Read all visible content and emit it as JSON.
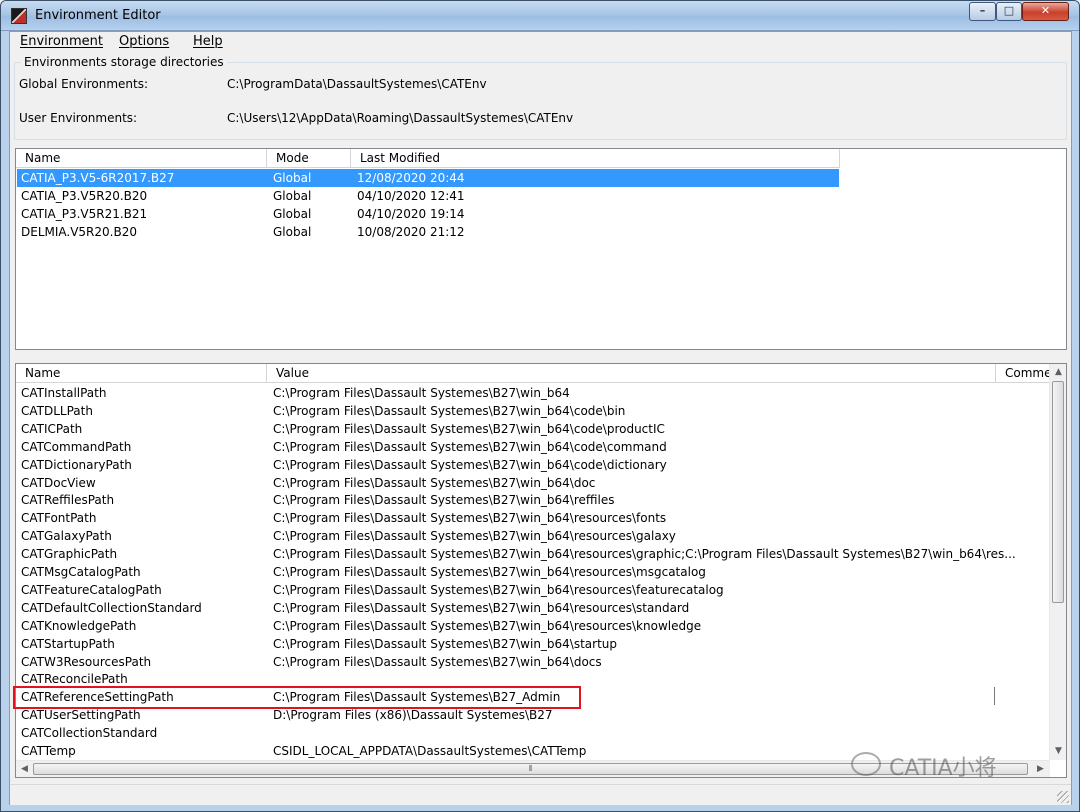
{
  "window": {
    "title": "Environment Editor",
    "controls": {
      "minimize": "–",
      "maximize": "□",
      "close": "✕"
    }
  },
  "menu": [
    "Environment",
    "Options",
    "Help"
  ],
  "storage": {
    "legend": "Environments storage directories",
    "global_label": "Global Environments:",
    "global_path": "C:\\ProgramData\\DassaultSystemes\\CATEnv",
    "user_label": "User   Environments:",
    "user_path": "C:\\Users\\12\\AppData\\Roaming\\DassaultSystemes\\CATEnv"
  },
  "environments": {
    "columns": [
      "Name",
      "Mode",
      "Last Modified"
    ],
    "selected_index": 0,
    "rows": [
      {
        "name": "CATIA_P3.V5-6R2017.B27",
        "mode": "Global",
        "modified": "12/08/2020  20:44"
      },
      {
        "name": "CATIA_P3.V5R20.B20",
        "mode": "Global",
        "modified": "04/10/2020  12:41"
      },
      {
        "name": "CATIA_P3.V5R21.B21",
        "mode": "Global",
        "modified": "04/10/2020  19:14"
      },
      {
        "name": "DELMIA.V5R20.B20",
        "mode": "Global",
        "modified": "10/08/2020  21:12"
      }
    ]
  },
  "variables": {
    "columns": [
      "Name",
      "Value",
      "Comme"
    ],
    "highlighted_index": 17,
    "rows": [
      {
        "name": "CATInstallPath",
        "value": "C:\\Program Files\\Dassault Systemes\\B27\\win_b64"
      },
      {
        "name": "CATDLLPath",
        "value": "C:\\Program Files\\Dassault Systemes\\B27\\win_b64\\code\\bin"
      },
      {
        "name": "CATICPath",
        "value": "C:\\Program Files\\Dassault Systemes\\B27\\win_b64\\code\\productIC"
      },
      {
        "name": "CATCommandPath",
        "value": "C:\\Program Files\\Dassault Systemes\\B27\\win_b64\\code\\command"
      },
      {
        "name": "CATDictionaryPath",
        "value": "C:\\Program Files\\Dassault Systemes\\B27\\win_b64\\code\\dictionary"
      },
      {
        "name": "CATDocView",
        "value": "C:\\Program Files\\Dassault Systemes\\B27\\win_b64\\doc"
      },
      {
        "name": "CATReffilesPath",
        "value": "C:\\Program Files\\Dassault Systemes\\B27\\win_b64\\reffiles"
      },
      {
        "name": "CATFontPath",
        "value": "C:\\Program Files\\Dassault Systemes\\B27\\win_b64\\resources\\fonts"
      },
      {
        "name": "CATGalaxyPath",
        "value": "C:\\Program Files\\Dassault Systemes\\B27\\win_b64\\resources\\galaxy"
      },
      {
        "name": "CATGraphicPath",
        "value": "C:\\Program Files\\Dassault Systemes\\B27\\win_b64\\resources\\graphic;C:\\Program Files\\Dassault Systemes\\B27\\win_b64\\res..."
      },
      {
        "name": "CATMsgCatalogPath",
        "value": "C:\\Program Files\\Dassault Systemes\\B27\\win_b64\\resources\\msgcatalog"
      },
      {
        "name": "CATFeatureCatalogPath",
        "value": "C:\\Program Files\\Dassault Systemes\\B27\\win_b64\\resources\\featurecatalog"
      },
      {
        "name": "CATDefaultCollectionStandard",
        "value": "C:\\Program Files\\Dassault Systemes\\B27\\win_b64\\resources\\standard"
      },
      {
        "name": "CATKnowledgePath",
        "value": "C:\\Program Files\\Dassault Systemes\\B27\\win_b64\\resources\\knowledge"
      },
      {
        "name": "CATStartupPath",
        "value": "C:\\Program Files\\Dassault Systemes\\B27\\win_b64\\startup"
      },
      {
        "name": "CATW3ResourcesPath",
        "value": "C:\\Program Files\\Dassault Systemes\\B27\\win_b64\\docs"
      },
      {
        "name": "CATReconcilePath",
        "value": ""
      },
      {
        "name": "CATReferenceSettingPath",
        "value": "C:\\Program Files\\Dassault Systemes\\B27_Admin"
      },
      {
        "name": "CATUserSettingPath",
        "value": "D:\\Program Files (x86)\\Dassault Systemes\\B27"
      },
      {
        "name": "CATCollectionStandard",
        "value": ""
      },
      {
        "name": "CATTemp",
        "value": "CSIDL_LOCAL_APPDATA\\DassaultSystemes\\CATTemp"
      }
    ]
  },
  "watermark": "CATIA小将",
  "colors": {
    "selection": "#3399ff",
    "highlight_border": "#e0141e",
    "titlebar": "#a9c6e6"
  }
}
